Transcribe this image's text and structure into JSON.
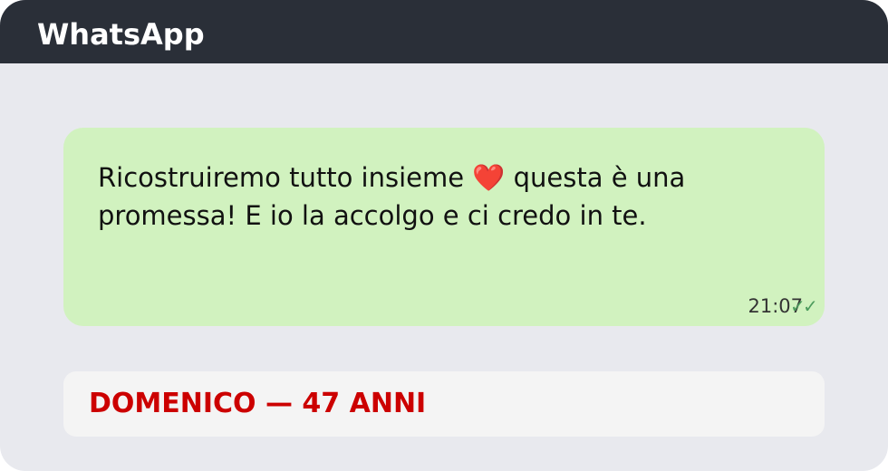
{
  "app": {
    "title": "WhatsApp"
  },
  "message": {
    "text": "Ricostruiremo tutto insieme ❤️ questa è una promessa! E io la accolgo e ci credo in te.",
    "time": "21:07",
    "status_glyph": "✓",
    "status_icon": "double-check-icon",
    "bubble_color": "#d1f2bf"
  },
  "caption": {
    "text": "DOMENICO — 47 ANNI",
    "color": "#cc0000"
  },
  "colors": {
    "header": "#2a2f38",
    "background": "#e8e9ee",
    "caption_card": "#f4f4f4",
    "check": "#4c9b5c"
  }
}
